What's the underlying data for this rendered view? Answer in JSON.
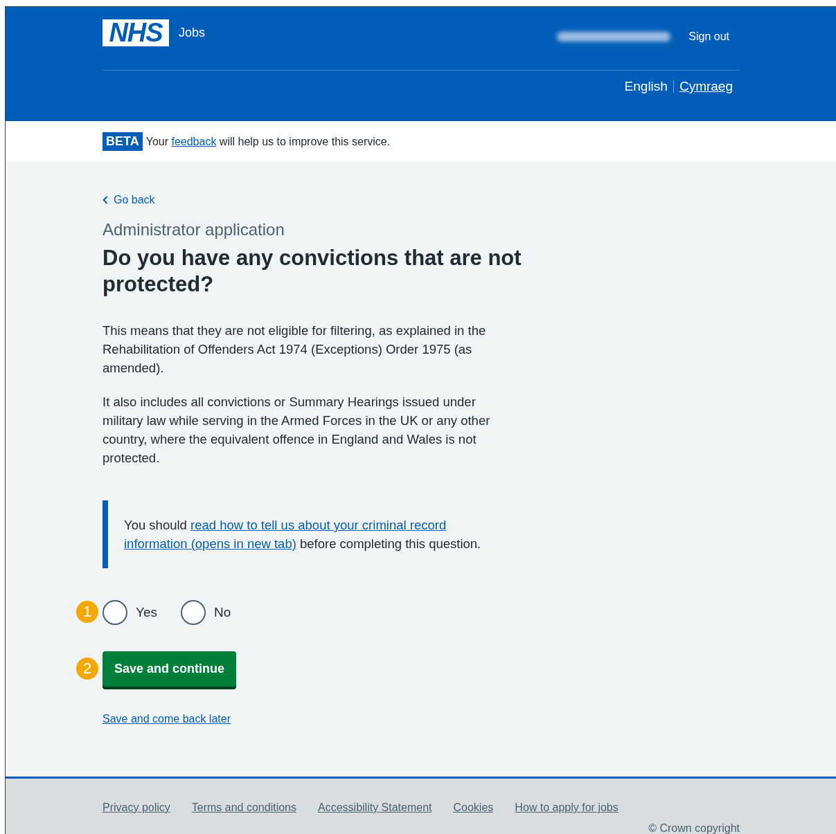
{
  "header": {
    "logo": "NHS",
    "service": "Jobs",
    "account": {
      "name_blurred": true
    },
    "sign_out": "Sign out",
    "languages": [
      {
        "label": "English",
        "selected": true
      },
      {
        "label": "Cymraeg",
        "selected": false
      }
    ]
  },
  "phase_banner": {
    "tag": "BETA",
    "before": "Your ",
    "link": "feedback",
    "after": " will help us to improve this service."
  },
  "back_link": "Go back",
  "caption": "Administrator application",
  "heading": "Do you have any convictions that are not protected?",
  "paragraphs": [
    "This means that they are not eligible for filtering, as explained in the Rehabilitation of Offenders Act 1974 (Exceptions) Order 1975 (as amended).",
    "It also includes all convictions or Summary Hearings issued under military law while serving in the Armed Forces in the UK or any other country, where the equivalent offence in England and Wales is not protected."
  ],
  "inset": {
    "before": "You should ",
    "link_lines": [
      "read how to tell us about your criminal record",
      "information (opens in new tab)"
    ],
    "after": " before completing this question."
  },
  "radios": [
    {
      "label": "Yes",
      "selected": false
    },
    {
      "label": "No",
      "selected": false
    }
  ],
  "annotations": [
    {
      "number": "1"
    },
    {
      "number": "2"
    }
  ],
  "primary_button": "Save and continue",
  "secondary_link": "Save and come back later",
  "footer": {
    "links": [
      "Privacy policy",
      "Terms and conditions",
      "Accessibility Statement",
      "Cookies",
      "How to apply for jobs"
    ],
    "copyright": "© Crown copyright"
  }
}
